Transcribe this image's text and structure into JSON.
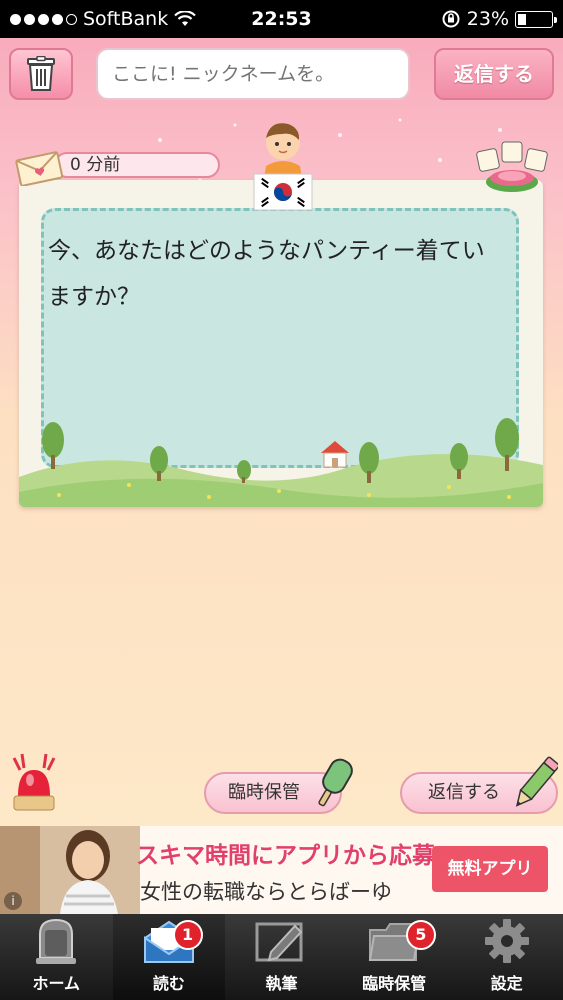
{
  "status_bar": {
    "carrier": "SoftBank",
    "time": "22:53",
    "battery_percent": "23%",
    "signal_bars_filled": 4,
    "signal_bars_total": 5
  },
  "header": {
    "nickname_placeholder": "ここに! ニックネームを。",
    "reply_label": "返信する"
  },
  "message": {
    "time_ago": "0 分前",
    "text": "今、あなたはどのようなパンティー着ていますか？",
    "sender_flag": "korea-flag-icon"
  },
  "actions": {
    "save_temp_label": "臨時保管",
    "reply_label": "返信する"
  },
  "ad": {
    "headline": "スキマ時間にアプリから応募!",
    "subline": "女性の転職ならとらばーゆ",
    "cta": "無料アプリ",
    "info": "i"
  },
  "tabs": [
    {
      "label": "ホーム",
      "icon": "mailbox-icon",
      "badge": ""
    },
    {
      "label": "読む",
      "icon": "open-envelope-icon",
      "badge": "1"
    },
    {
      "label": "執筆",
      "icon": "write-icon",
      "badge": ""
    },
    {
      "label": "臨時保管",
      "icon": "folder-icon",
      "badge": "5"
    },
    {
      "label": "設定",
      "icon": "gear-icon",
      "badge": ""
    }
  ],
  "colors": {
    "accent_pink": "#f08aa5",
    "card_mint": "#c9e6e1",
    "badge_red": "#e0222b",
    "ad_pink": "#e0406b"
  }
}
